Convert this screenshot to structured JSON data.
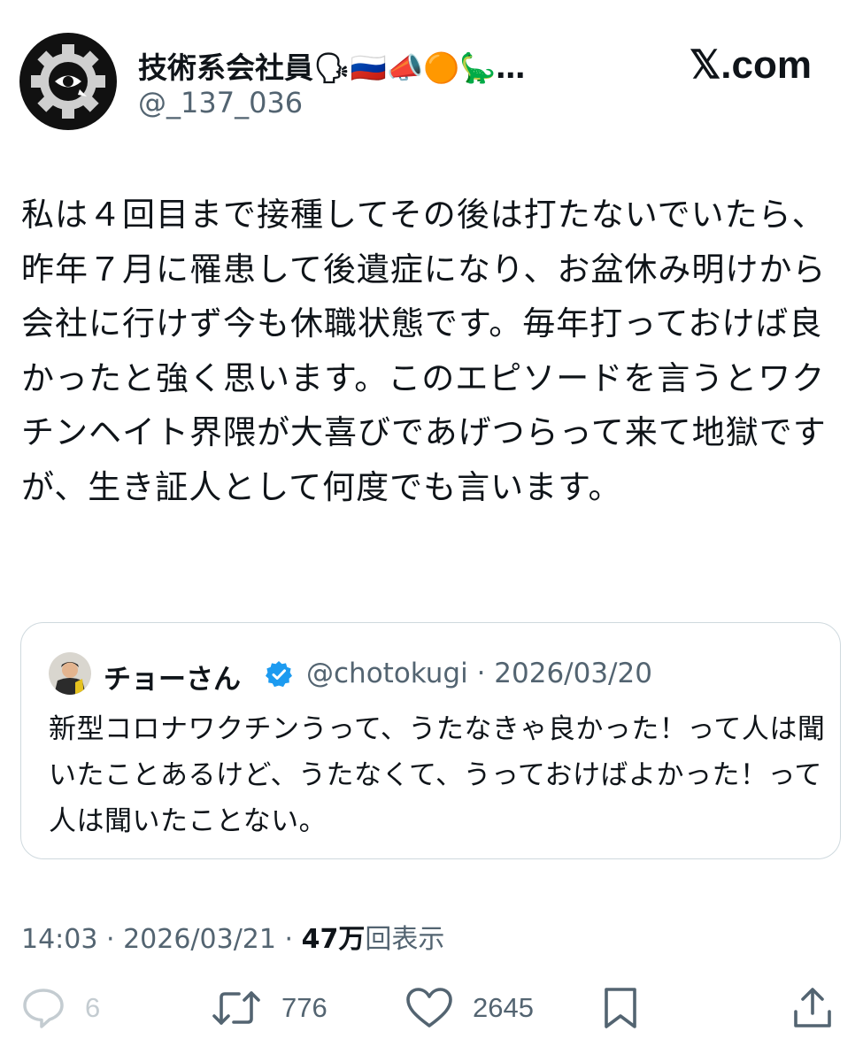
{
  "header": {
    "display_name": "技術系会社員🗣🇷🇺📣🟠🦕…",
    "handle": "@_137_036",
    "brand": "𝕏.com"
  },
  "tweet": {
    "text": "私は４回目まで接種してその後は打たないでいたら、昨年７月に罹患して後遺症になり、お盆休み明けから会社に行けず今も休職状態です。毎年打っておけば良かったと強く思います。このエピソードを言うとワクチンヘイト界隈が大喜びであげつらって来て地獄ですが、生き証人として何度でも言います。"
  },
  "quote": {
    "name": "チョーさん",
    "handle_and_date": "@chotokugi · 2026/03/20",
    "text": "新型コロナワクチンうって、うたなきゃ良かった！って人は聞いたことあるけど、うたなくて、うっておけばよかった！って人は聞いたことない。",
    "verified_color": "#1d9bf0"
  },
  "meta": {
    "time_date": "14:03 · 2026/03/21 · ",
    "views_count": "47万",
    "views_label": "回表示"
  },
  "actions": {
    "replies": "6",
    "reposts": "776",
    "likes": "2645",
    "icons": [
      "reply-icon",
      "repost-icon",
      "like-icon",
      "bookmark-icon",
      "share-icon"
    ]
  },
  "colors": {
    "text": "#0f1419",
    "secondary": "#536471",
    "border": "#cfd9de",
    "verified": "#1d9bf0"
  }
}
